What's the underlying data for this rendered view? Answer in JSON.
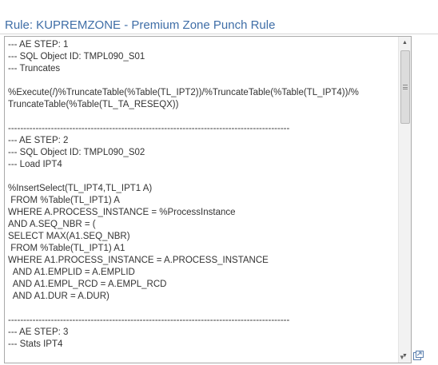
{
  "page": {
    "title": "Rule: KUPREMZONE - Premium Zone Punch Rule"
  },
  "sql_text": {
    "content": "--- AE STEP: 1\n--- SQL Object ID: TMPL090_S01\n--- Truncates\n\n%Execute(/)%TruncateTable(%Table(TL_IPT2))/%TruncateTable(%Table(TL_IPT4))/%\nTruncateTable(%Table(TL_TA_RESEQX))\n\n--------------------------------------------------------------------------------------------\n--- AE STEP: 2\n--- SQL Object ID: TMPL090_S02\n--- Load IPT4\n\n%InsertSelect(TL_IPT4,TL_IPT1 A)\n FROM %Table(TL_IPT1) A\nWHERE A.PROCESS_INSTANCE = %ProcessInstance\nAND A.SEQ_NBR = (\nSELECT MAX(A1.SEQ_NBR)\n FROM %Table(TL_IPT1) A1\nWHERE A1.PROCESS_INSTANCE = A.PROCESS_INSTANCE\n  AND A1.EMPLID = A.EMPLID\n  AND A1.EMPL_RCD = A.EMPL_RCD\n  AND A1.DUR = A.DUR)\n\n--------------------------------------------------------------------------------------------\n--- AE STEP: 3\n--- Stats IPT4"
  },
  "icons": {
    "scroll_up": "triangle-up-icon",
    "scroll_down": "triangle-down-icon",
    "resize": "resize-down-icon",
    "expand": "expand-window-icon"
  },
  "colors": {
    "title": "#3f6ea7",
    "text": "#333333",
    "border": "#a9a9a9"
  }
}
